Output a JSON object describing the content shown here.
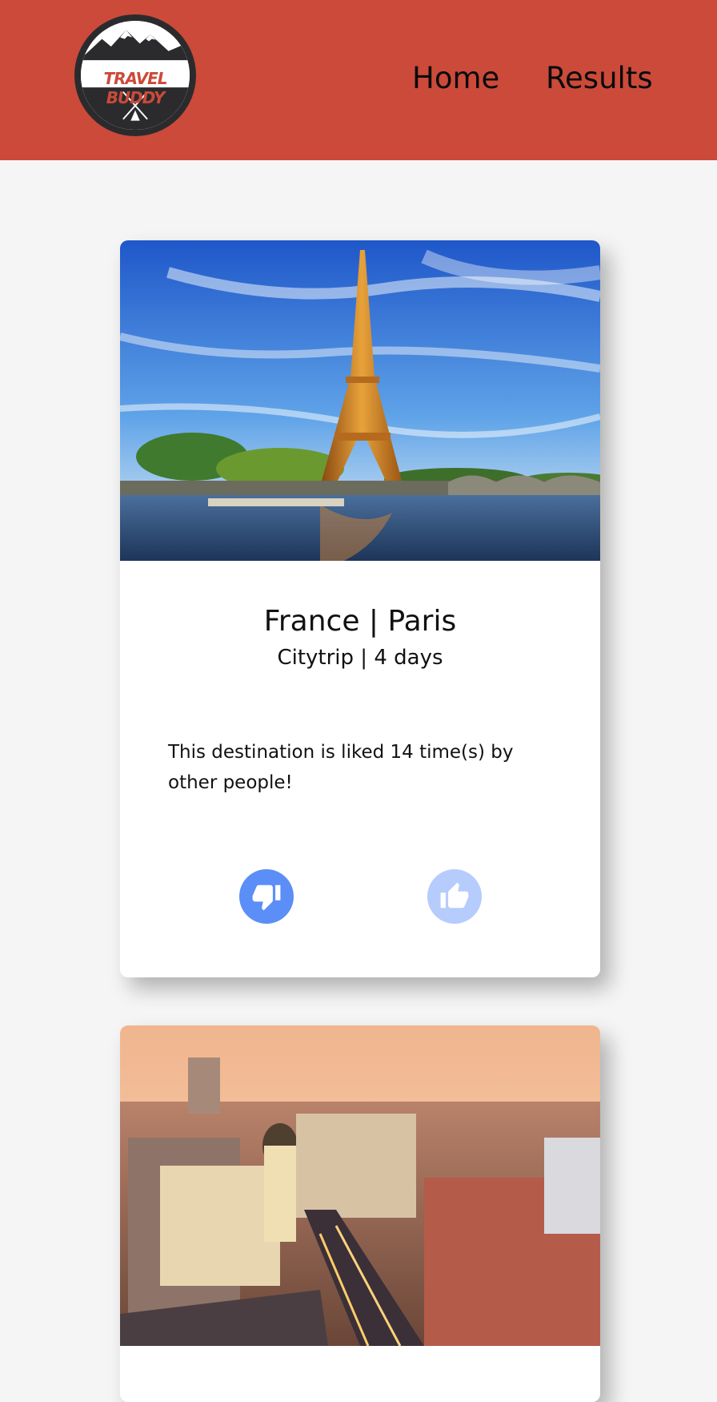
{
  "header": {
    "logo_text": "TRAVEL BUDDY",
    "nav": [
      {
        "label": "Home"
      },
      {
        "label": "Results"
      }
    ]
  },
  "cards": [
    {
      "title": "France | Paris",
      "subtitle": "Citytrip | 4 days",
      "description": "This destination is liked 14 time(s) by other people!",
      "image": "eiffel-tower-photo"
    },
    {
      "image": "madrid-city-photo"
    }
  ],
  "colors": {
    "header_bg": "#cb4a3a",
    "page_bg": "#f5f5f5",
    "dislike_button": "#5b8ef7",
    "like_button": "#b5ccfc"
  },
  "icons": [
    "thumbs-down-icon",
    "thumbs-up-icon"
  ]
}
